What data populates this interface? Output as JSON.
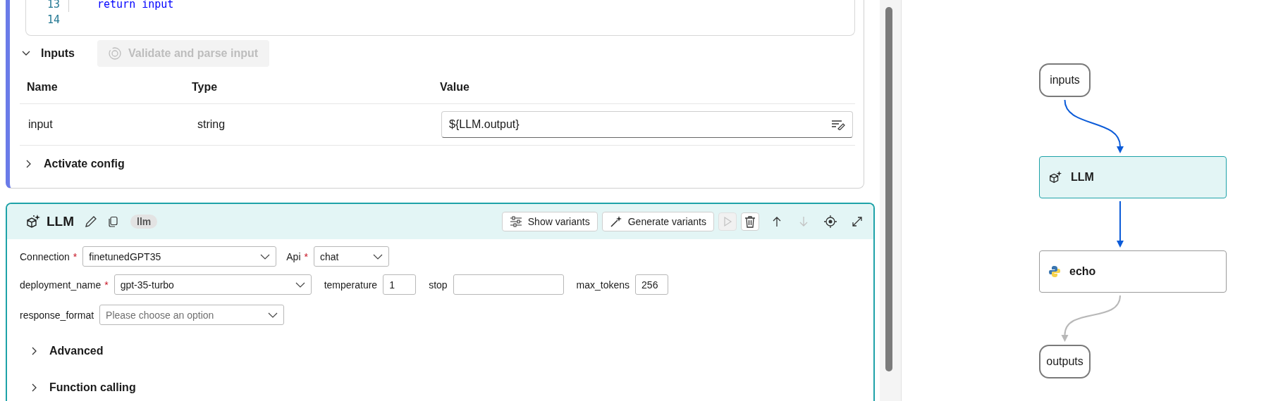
{
  "code_editor": {
    "lines": [
      {
        "number": "13",
        "text": "return input"
      },
      {
        "number": "14"
      }
    ]
  },
  "inputs_section": {
    "title": "Inputs",
    "expanded": true,
    "validate_button": {
      "label": "Validate and parse input",
      "disabled": true
    },
    "columns": [
      "Name",
      "Type",
      "Value"
    ],
    "rows": [
      {
        "name": "input",
        "type": "string",
        "value": "${LLM.output}"
      }
    ]
  },
  "activate_config": {
    "title": "Activate config",
    "expanded": false
  },
  "llm_node": {
    "title": "LLM",
    "badge": "llm",
    "toolbar": [
      {
        "kind": "show-variants",
        "label": "Show variants"
      },
      {
        "kind": "generate-variants",
        "label": "Generate variants"
      },
      {
        "kind": "run",
        "disabled": true
      },
      {
        "kind": "delete",
        "disabled": false
      },
      {
        "kind": "up",
        "disabled": false
      },
      {
        "kind": "down",
        "disabled": true
      },
      {
        "kind": "locate",
        "disabled": false
      },
      {
        "kind": "expand",
        "disabled": false
      }
    ],
    "field_rows": [
      [
        {
          "label": "Connection",
          "required_mark": "*",
          "kind": "dropdown",
          "value": "finetunedGPT35"
        },
        {
          "label": "Api",
          "required_mark": "*",
          "kind": "dropdown",
          "value": "chat"
        }
      ],
      [
        {
          "label": "deployment_name",
          "required_mark": "*",
          "kind": "dropdown",
          "value": "gpt-35-turbo"
        },
        {
          "label": "temperature",
          "kind": "text",
          "value": "1"
        },
        {
          "label": "stop",
          "kind": "text"
        },
        {
          "label": "max_tokens",
          "kind": "text",
          "value": "256"
        }
      ],
      [
        {
          "label": "response_format",
          "kind": "dropdown",
          "placeholder": "Please choose an option"
        }
      ]
    ],
    "sections": [
      {
        "title": "Advanced",
        "expanded": false
      },
      {
        "title": "Function calling",
        "expanded": false
      }
    ]
  },
  "graph": {
    "nodes": [
      {
        "kind": "io",
        "label": "inputs",
        "selected": false
      },
      {
        "kind": "llm",
        "label": "LLM",
        "selected": true
      },
      {
        "kind": "python",
        "label": "echo",
        "selected": false
      },
      {
        "kind": "io",
        "label": "outputs",
        "selected": false
      }
    ],
    "edges": [
      {
        "active": true
      },
      {
        "active": true
      },
      {
        "active": false
      }
    ]
  }
}
